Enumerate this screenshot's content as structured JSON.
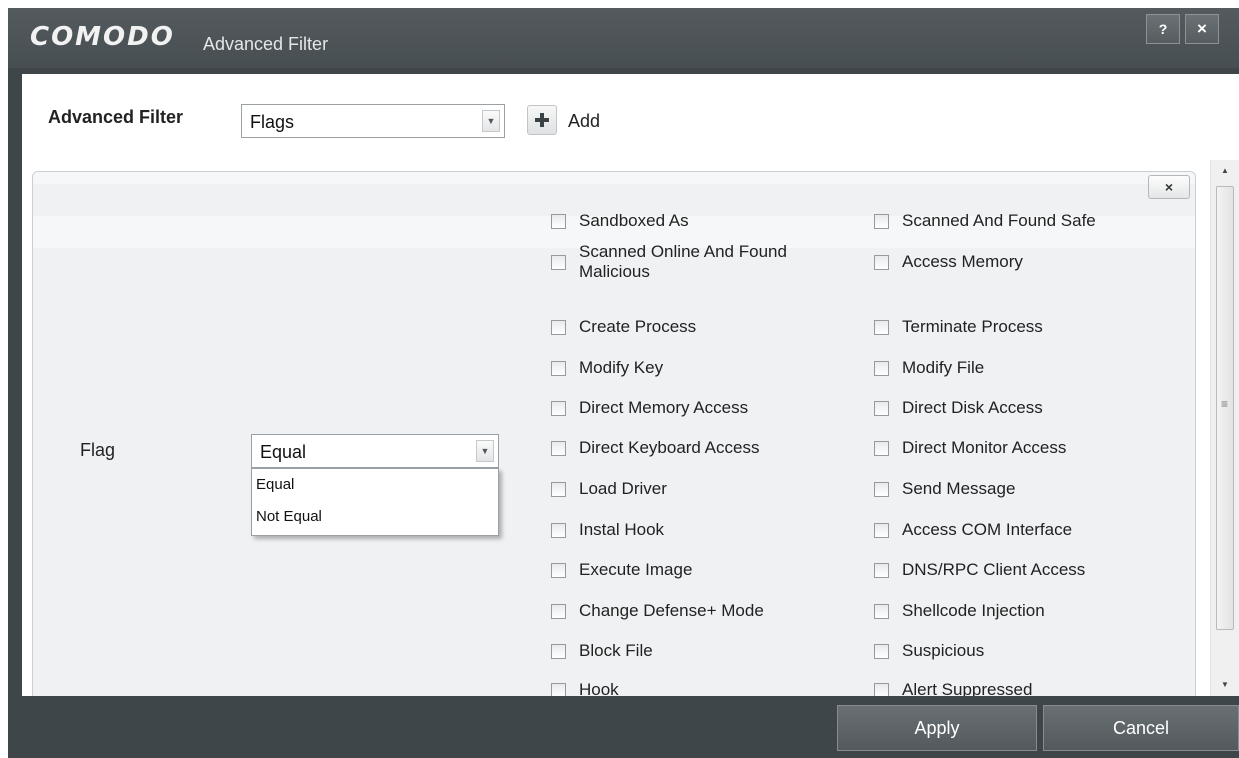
{
  "window": {
    "logo": "COMODO",
    "title": "Advanced Filter",
    "help_button": "?",
    "close_button": "×"
  },
  "filter": {
    "label": "Advanced Filter",
    "type_value": "Flags",
    "add_label": "Add"
  },
  "panel": {
    "close_label": "×",
    "field_label": "Flag",
    "operator_value": "Equal",
    "operator_options": [
      "Equal",
      "Not Equal"
    ],
    "flags_left": [
      "Sandboxed As",
      "Scanned Online And Found Malicious",
      "Create Process",
      "Modify Key",
      "Direct Memory Access",
      "Direct Keyboard Access",
      "Load Driver",
      "Instal Hook",
      "Execute Image",
      "Change Defense+ Mode",
      "Block File",
      "Hook"
    ],
    "flags_right": [
      "Scanned And Found Safe",
      "Access Memory",
      "Terminate Process",
      "Modify File",
      "Direct Disk Access",
      "Direct Monitor Access",
      "Send Message",
      "Access COM Interface",
      "DNS/RPC Client Access",
      "Shellcode Injection",
      "Suspicious",
      "Alert Suppressed"
    ]
  },
  "footer": {
    "apply_label": "Apply",
    "cancel_label": "Cancel"
  },
  "colors": {
    "titlebar": "#4b5256",
    "footer": "#3f4649",
    "panel": "#eff1f3"
  }
}
